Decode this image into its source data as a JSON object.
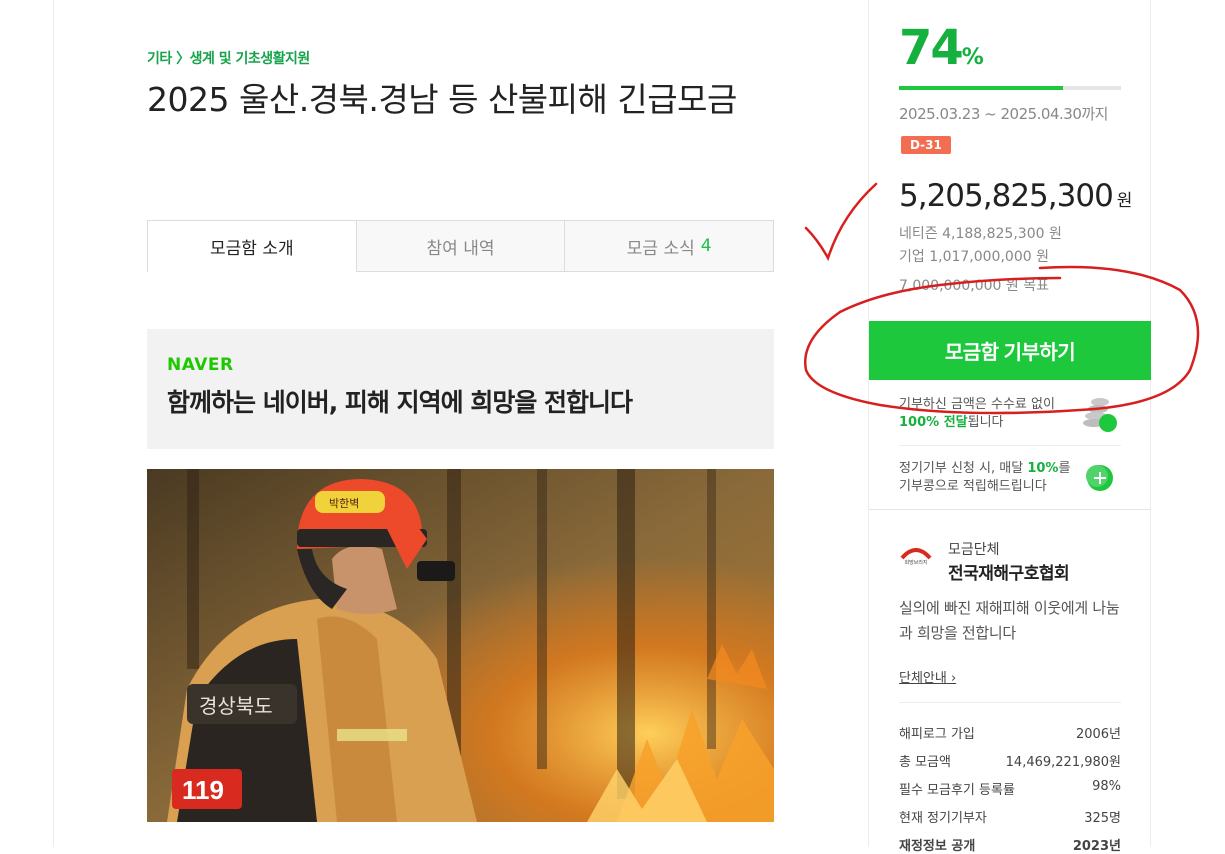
{
  "breadcrumb": "기타 〉생계 및 기초생활지원",
  "title": "2025 울산.경북.경남 등 산불피해 긴급모금",
  "tabs": [
    {
      "label": "모금함 소개",
      "count": ""
    },
    {
      "label": "참여 내역",
      "count": ""
    },
    {
      "label": "모금 소식",
      "count": "4"
    }
  ],
  "banner": {
    "brand": "NAVER",
    "headline": "함께하는 네이버, 피해 지역에 희망을 전합니다"
  },
  "photo": {
    "vest_text": "경상북도",
    "helmet_text": "박한벽",
    "badge_text": "119"
  },
  "sidebar": {
    "percent": "74",
    "percent_symbol": "%",
    "progress": 0.74,
    "period": "2025.03.23 ~ 2025.04.30까지",
    "dday": "D-31",
    "amount": "5,205,825,300",
    "amount_unit": "원",
    "netizen": "네티즌 4,188,825,300 원",
    "company": "기업 1,017,000,000 원",
    "goal": "7,000,000,000 원 목표",
    "donate_button": "모금함 기부하기",
    "fee_text": "기부하신 금액은 수수료 없이",
    "fee_highlight": "100% 전달",
    "fee_suffix": "됩니다",
    "regular_prefix": "정기기부 신청 시, 매달 ",
    "regular_highlight": "10%",
    "regular_suffix": "를",
    "regular_line2": "기부콩으로 적립해드립니다"
  },
  "org": {
    "logo_text": "희망브리지",
    "label": "모금단체",
    "name": "전국재해구호협회",
    "description": "실의에 빠진 재해피해 이웃에게 나눔과 희망을 전합니다",
    "link": "단체안내 ›",
    "stats": [
      {
        "label": "해피로그 가입",
        "value": "2006년"
      },
      {
        "label": "총 모금액",
        "value": "14,469,221,980원"
      },
      {
        "label": "필수 모금후기 등록률",
        "value": "98%"
      },
      {
        "label": "현재 정기기부자",
        "value": "325명"
      },
      {
        "label": "재정정보 공개",
        "value": "2023년"
      }
    ]
  },
  "colors": {
    "accent": "#1ec83c",
    "dday": "#f26d51",
    "annotation": "#d81f1f"
  }
}
